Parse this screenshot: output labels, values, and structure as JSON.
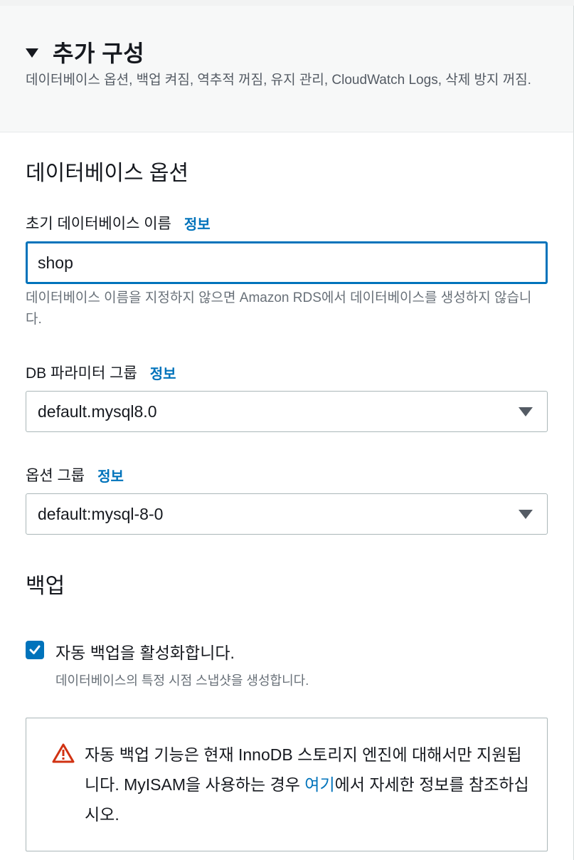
{
  "section": {
    "title": "추가 구성",
    "description": "데이터베이스 옵션, 백업 켜짐, 역추적 꺼짐, 유지 관리, CloudWatch Logs, 삭제 방지 꺼짐."
  },
  "db_options": {
    "heading": "데이터베이스 옵션",
    "initial_db": {
      "label": "초기 데이터베이스 이름",
      "info": "정보",
      "value": "shop",
      "hint": "데이터베이스 이름을 지정하지 않으면 Amazon RDS에서 데이터베이스를 생성하지 않습니다."
    },
    "param_group": {
      "label": "DB 파라미터 그룹",
      "info": "정보",
      "selected": "default.mysql8.0"
    },
    "option_group": {
      "label": "옵션 그룹",
      "info": "정보",
      "selected": "default:mysql-8-0"
    }
  },
  "backup": {
    "heading": "백업",
    "auto_backup": {
      "checked": true,
      "label": "자동 백업을 활성화합니다.",
      "sub": "데이터베이스의 특정 시점 스냅샷을 생성합니다."
    },
    "alert": {
      "text_before": "자동 백업 기능은 현재 InnoDB 스토리지 엔진에 대해서만 지원됩니다. MyISAM을 사용하는 경우 ",
      "link": "여기",
      "text_after": "에서 자세한 정보를 참조하십시오.",
      "icon": "warning-icon",
      "icon_color": "#d13212"
    }
  },
  "colors": {
    "accent": "#0073bb",
    "warning": "#d13212"
  }
}
